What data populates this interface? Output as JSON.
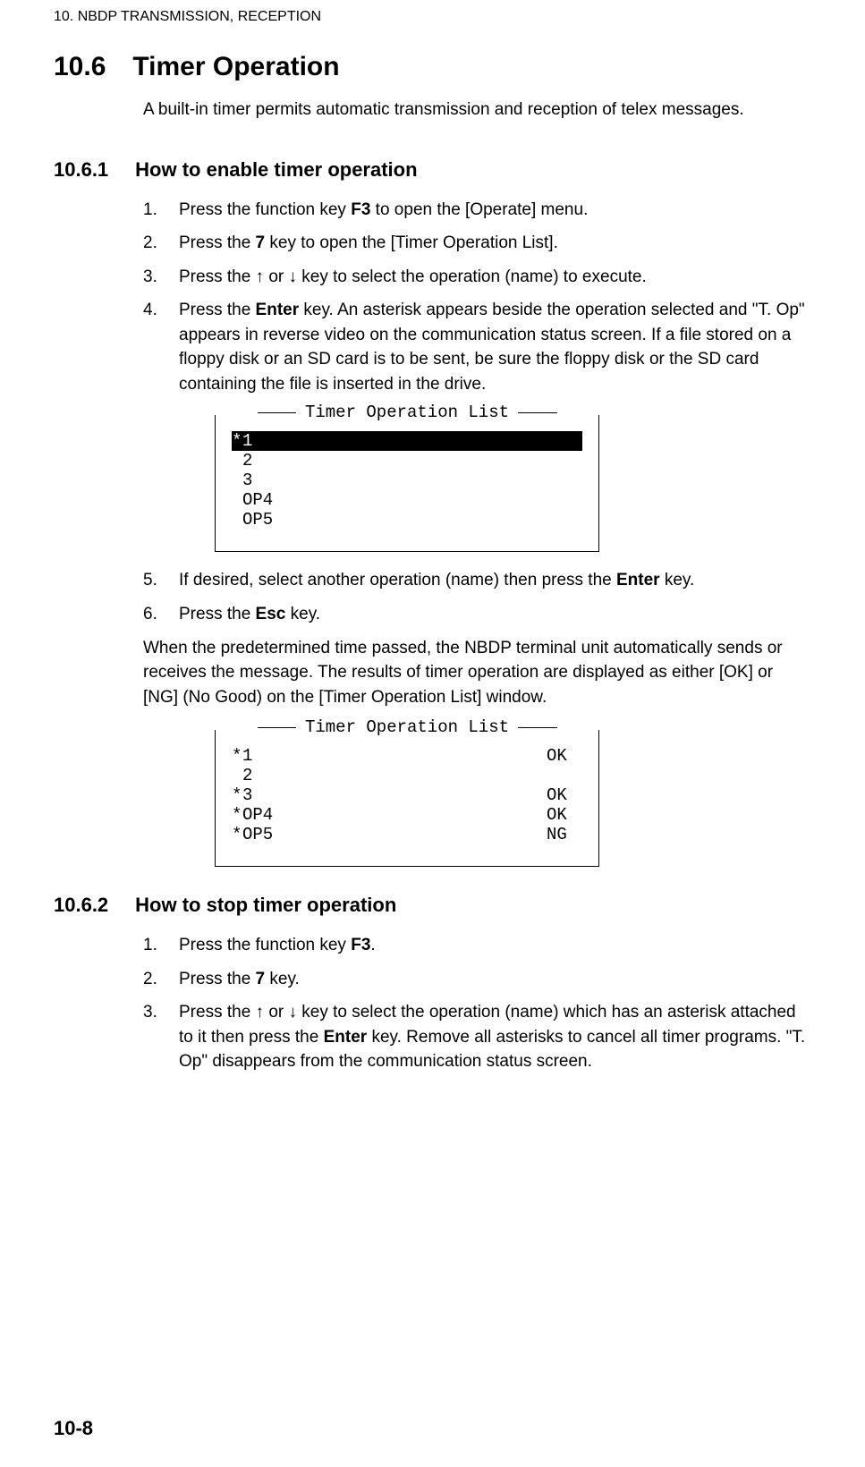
{
  "chapterHeader": "10.  NBDP TRANSMISSION, RECEPTION",
  "h1": {
    "num": "10.6",
    "title": "Timer Operation"
  },
  "intro": "A built-in timer permits automatic transmission and reception of telex messages.",
  "s1": {
    "num": "10.6.1",
    "title": "How to enable timer operation",
    "li1": {
      "n": "1.",
      "a": "Press the function key ",
      "b": "F3",
      "c": " to open the [Operate] menu."
    },
    "li2": {
      "n": "2.",
      "a": "Press the ",
      "b": "7",
      "c": " key to open the [Timer Operation List]."
    },
    "li3": {
      "n": "3.",
      "a": "Press the ↑ or ↓ key to select the operation (name) to execute."
    },
    "li4": {
      "n": "4.",
      "a": "Press the ",
      "b": "Enter",
      "c": " key. An asterisk appears beside the operation selected and \"T. Op\" appears in reverse video on the communication status screen. If a file stored on a floppy disk or an SD card is to be sent, be sure the floppy disk or the SD card containing the file is inserted in the drive."
    },
    "li5": {
      "n": "5.",
      "a": "If desired, select another operation (name) then press the ",
      "b": "Enter",
      "c": " key."
    },
    "li6": {
      "n": "6.",
      "a": "Press the ",
      "b": "Esc",
      "c": " key."
    },
    "para": "When the predetermined time passed, the NBDP terminal unit automatically sends or receives the message. The results of timer operation are displayed as either [OK] or [NG] (No Good) on the [Timer Operation List] window."
  },
  "fig1": {
    "title": "Timer Operation List",
    "rows": [
      {
        "pre": "*",
        "name": "1",
        "status": "",
        "selected": true
      },
      {
        "pre": " ",
        "name": "2",
        "status": ""
      },
      {
        "pre": " ",
        "name": "3",
        "status": ""
      },
      {
        "pre": " ",
        "name": "OP4",
        "status": ""
      },
      {
        "pre": " ",
        "name": "OP5",
        "status": ""
      }
    ]
  },
  "fig2": {
    "title": "Timer Operation List",
    "rows": [
      {
        "pre": "*",
        "name": "1",
        "status": "OK"
      },
      {
        "pre": " ",
        "name": "2",
        "status": ""
      },
      {
        "pre": "*",
        "name": "3",
        "status": "OK"
      },
      {
        "pre": "*",
        "name": "OP4",
        "status": "OK"
      },
      {
        "pre": "*",
        "name": "OP5",
        "status": "NG"
      }
    ]
  },
  "s2": {
    "num": "10.6.2",
    "title": "How to stop timer operation",
    "li1": {
      "n": "1.",
      "a": "Press the function key ",
      "b": "F3",
      "c": "."
    },
    "li2": {
      "n": "2.",
      "a": "Press the ",
      "b": "7",
      "c": " key."
    },
    "li3": {
      "n": "3.",
      "a": "Press the ↑ or ↓ key to select the operation (name) which has an asterisk attached to it then press the ",
      "b": "Enter",
      "c": " key. Remove all asterisks to cancel all timer programs. \"T. Op\" disappears from the communication status screen."
    }
  },
  "pageNum": "10-8"
}
